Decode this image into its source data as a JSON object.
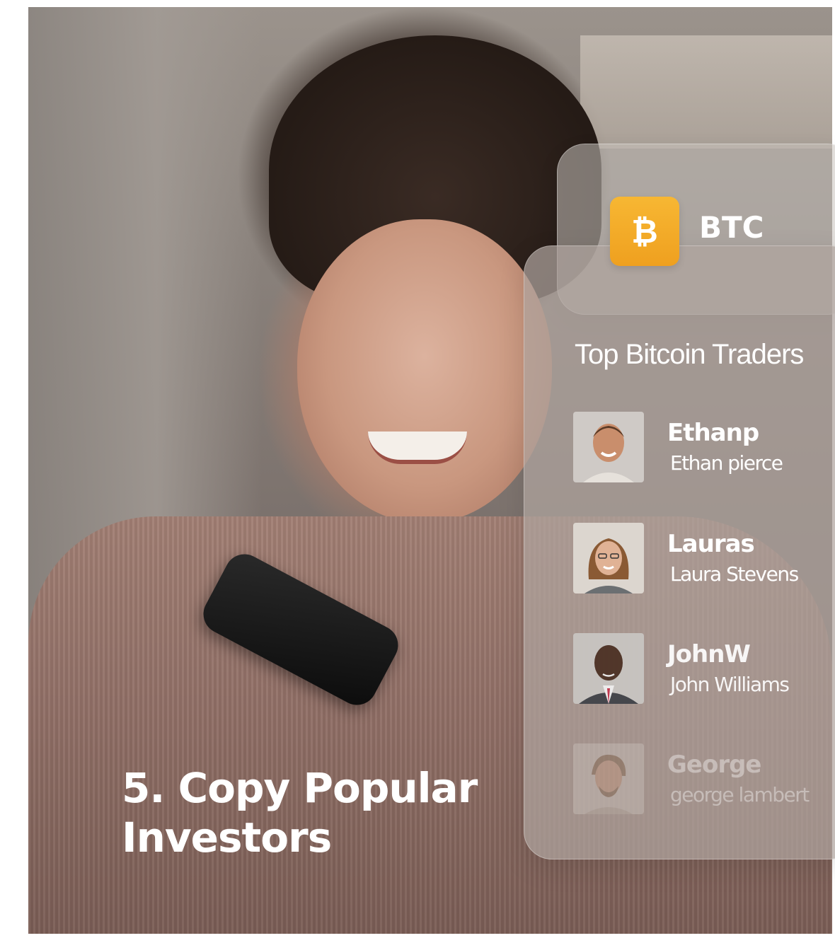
{
  "coin": {
    "symbol_glyph": "₿",
    "ticker": "BTC",
    "badge_color": "#f5ab28"
  },
  "traders_panel": {
    "title": "Top Bitcoin Traders",
    "traders": [
      {
        "username": "Ethanp",
        "full_name": "Ethan pierce"
      },
      {
        "username": "Lauras",
        "full_name": "Laura Stevens"
      },
      {
        "username": "JohnW",
        "full_name": "John Williams"
      },
      {
        "username": "George",
        "full_name": "george lambert"
      }
    ]
  },
  "headline": {
    "line1": "5. Copy Popular",
    "line2": "Investors"
  }
}
